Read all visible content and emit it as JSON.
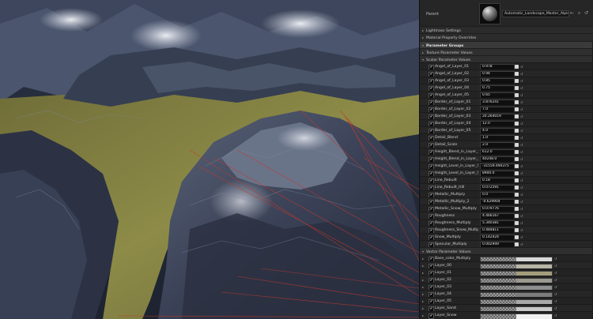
{
  "parent": {
    "label": "Parent",
    "value": "Automatic_Landscape_Master_Alpine"
  },
  "sections": {
    "lightmass": "Lightmass Settings",
    "material_overrides": "Material Property Overrides",
    "parameter_groups": "Parameter Groups",
    "texture_params": "Texture Parameter Values",
    "scalar_params": "Scalar Parameter Values",
    "vector_params": "Vector Parameter Values"
  },
  "scalar_params": [
    {
      "name": "Angel_of_Layer_01",
      "value": "0.978"
    },
    {
      "name": "Angel_of_Layer_02",
      "value": "0.94"
    },
    {
      "name": "Angel_of_Layer_03",
      "value": "0.85"
    },
    {
      "name": "Angel_of_Layer_04",
      "value": "0.75"
    },
    {
      "name": "Angel_of_Layer_05",
      "value": "0.65"
    },
    {
      "name": "Border_of_Layer_01",
      "value": "3.876241"
    },
    {
      "name": "Border_of_Layer_02",
      "value": "7.0"
    },
    {
      "name": "Border_of_Layer_03",
      "value": "20.264019"
    },
    {
      "name": "Border_of_Layer_04",
      "value": "12.0"
    },
    {
      "name": "Border_of_Layer_05",
      "value": "4.0"
    },
    {
      "name": "Detail_Blend",
      "value": "1.0"
    },
    {
      "name": "Detail_Scale",
      "value": "2.0"
    },
    {
      "name": "Height_Blend_in_Layer_Sand",
      "value": "612.0"
    },
    {
      "name": "Height_Blend_in_Layer_Snow",
      "value": "40248.0"
    },
    {
      "name": "Height_Level_in_Layer_Sand",
      "value": "-31559.494375"
    },
    {
      "name": "Height_Level_in_Layer_Snow",
      "value": "8900.0"
    },
    {
      "name": "Line_Rebuilt",
      "value": "0.18"
    },
    {
      "name": "Line_Rebuilt_Hill",
      "value": "0.072591"
    },
    {
      "name": "Metallic_Multiply",
      "value": "0.0"
    },
    {
      "name": "Metallic_Multiply_2",
      "value": "-0.629904"
    },
    {
      "name": "Metallic_Snow_Multiply",
      "value": "0.079776"
    },
    {
      "name": "Roughness",
      "value": "4.466167"
    },
    {
      "name": "Roughness_Multiply",
      "value": "5.340381"
    },
    {
      "name": "Roughness_Snow_Multiply",
      "value": "0.484811"
    },
    {
      "name": "Snow_Multiply",
      "value": "0.142424"
    },
    {
      "name": "Specular_Multiply",
      "value": "0.002949"
    }
  ],
  "vector_params": [
    {
      "name": "Base_color_Multiply",
      "color": "#d9d9d9"
    },
    {
      "name": "Layer_00",
      "color": "#b8b5a6"
    },
    {
      "name": "Layer_01",
      "color": "#a49d7c"
    },
    {
      "name": "Layer_02",
      "color": "#9c9a90"
    },
    {
      "name": "Layer_03",
      "color": "#8e8e8e"
    },
    {
      "name": "Layer_04",
      "color": "#7d7d7d"
    },
    {
      "name": "Layer_05",
      "color": "#a8a8a8"
    },
    {
      "name": "Layer_Sand",
      "color": "#c8c8c8"
    },
    {
      "name": "Layer_Snow",
      "color": "#f0f0f0"
    }
  ],
  "icons": {
    "checkbox": "✔",
    "reset": "↺",
    "expand": "▸",
    "collapse": "▾",
    "browse": "⌕",
    "use": "←"
  },
  "colors": {
    "panel_bg": "#242424",
    "terrain_grass": "#8b8a45",
    "terrain_rock": "#3a4050",
    "snow": "#dfe3ea",
    "guide_lines": "#c0392b"
  }
}
